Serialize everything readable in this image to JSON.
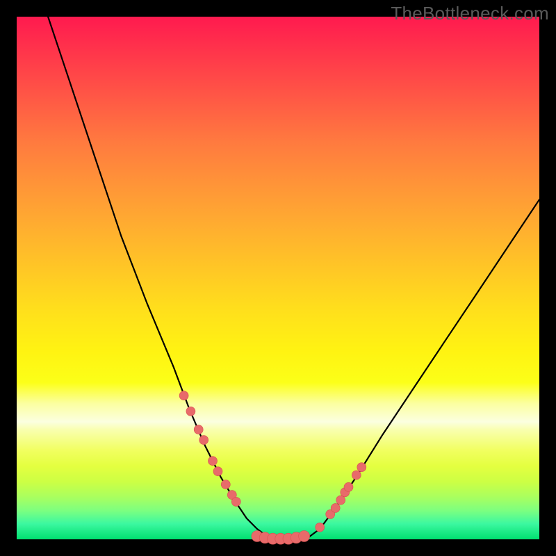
{
  "watermark": "TheBottleneck.com",
  "chart_data": {
    "type": "line",
    "title": "",
    "xlabel": "",
    "ylabel": "",
    "xlim": [
      0,
      100
    ],
    "ylim": [
      0,
      100
    ],
    "curve_left": {
      "name": "left-branch",
      "x": [
        6,
        10,
        15,
        20,
        25,
        30,
        33,
        36,
        39,
        42,
        44,
        46,
        48
      ],
      "y": [
        100,
        88,
        73,
        58,
        45,
        33,
        25,
        18,
        12,
        7,
        4,
        2,
        0.5
      ]
    },
    "curve_bottom": {
      "name": "valley-floor",
      "x": [
        48,
        50,
        52,
        54,
        56
      ],
      "y": [
        0.5,
        0,
        0,
        0,
        0.5
      ]
    },
    "curve_right": {
      "name": "right-branch",
      "x": [
        56,
        58,
        61,
        65,
        70,
        76,
        82,
        88,
        94,
        100
      ],
      "y": [
        0.5,
        2,
        6,
        12,
        20,
        29,
        38,
        47,
        56,
        65
      ]
    },
    "markers_left": {
      "name": "left-branch-dots",
      "x": [
        32.0,
        33.3,
        34.8,
        35.8,
        37.5,
        38.5,
        40.0,
        41.2,
        42.0
      ],
      "y": [
        27.5,
        24.5,
        21.0,
        19.0,
        15.0,
        13.0,
        10.5,
        8.5,
        7.2
      ]
    },
    "markers_right": {
      "name": "right-branch-dots",
      "x": [
        58.0,
        60.0,
        61.0,
        62.0,
        62.8,
        63.5,
        65.0,
        66.0
      ],
      "y": [
        2.3,
        4.8,
        6.0,
        7.5,
        9.0,
        10.0,
        12.3,
        13.8
      ]
    },
    "markers_bottom": {
      "name": "valley-dots",
      "x": [
        46.0,
        47.5,
        49.0,
        50.5,
        52.0,
        53.5,
        55.0
      ],
      "y": [
        0.6,
        0.3,
        0.1,
        0.1,
        0.1,
        0.3,
        0.6
      ]
    },
    "colors": {
      "curve": "#000000",
      "marker_fill": "#e86a6a",
      "marker_stroke": "#d94f4f"
    }
  }
}
